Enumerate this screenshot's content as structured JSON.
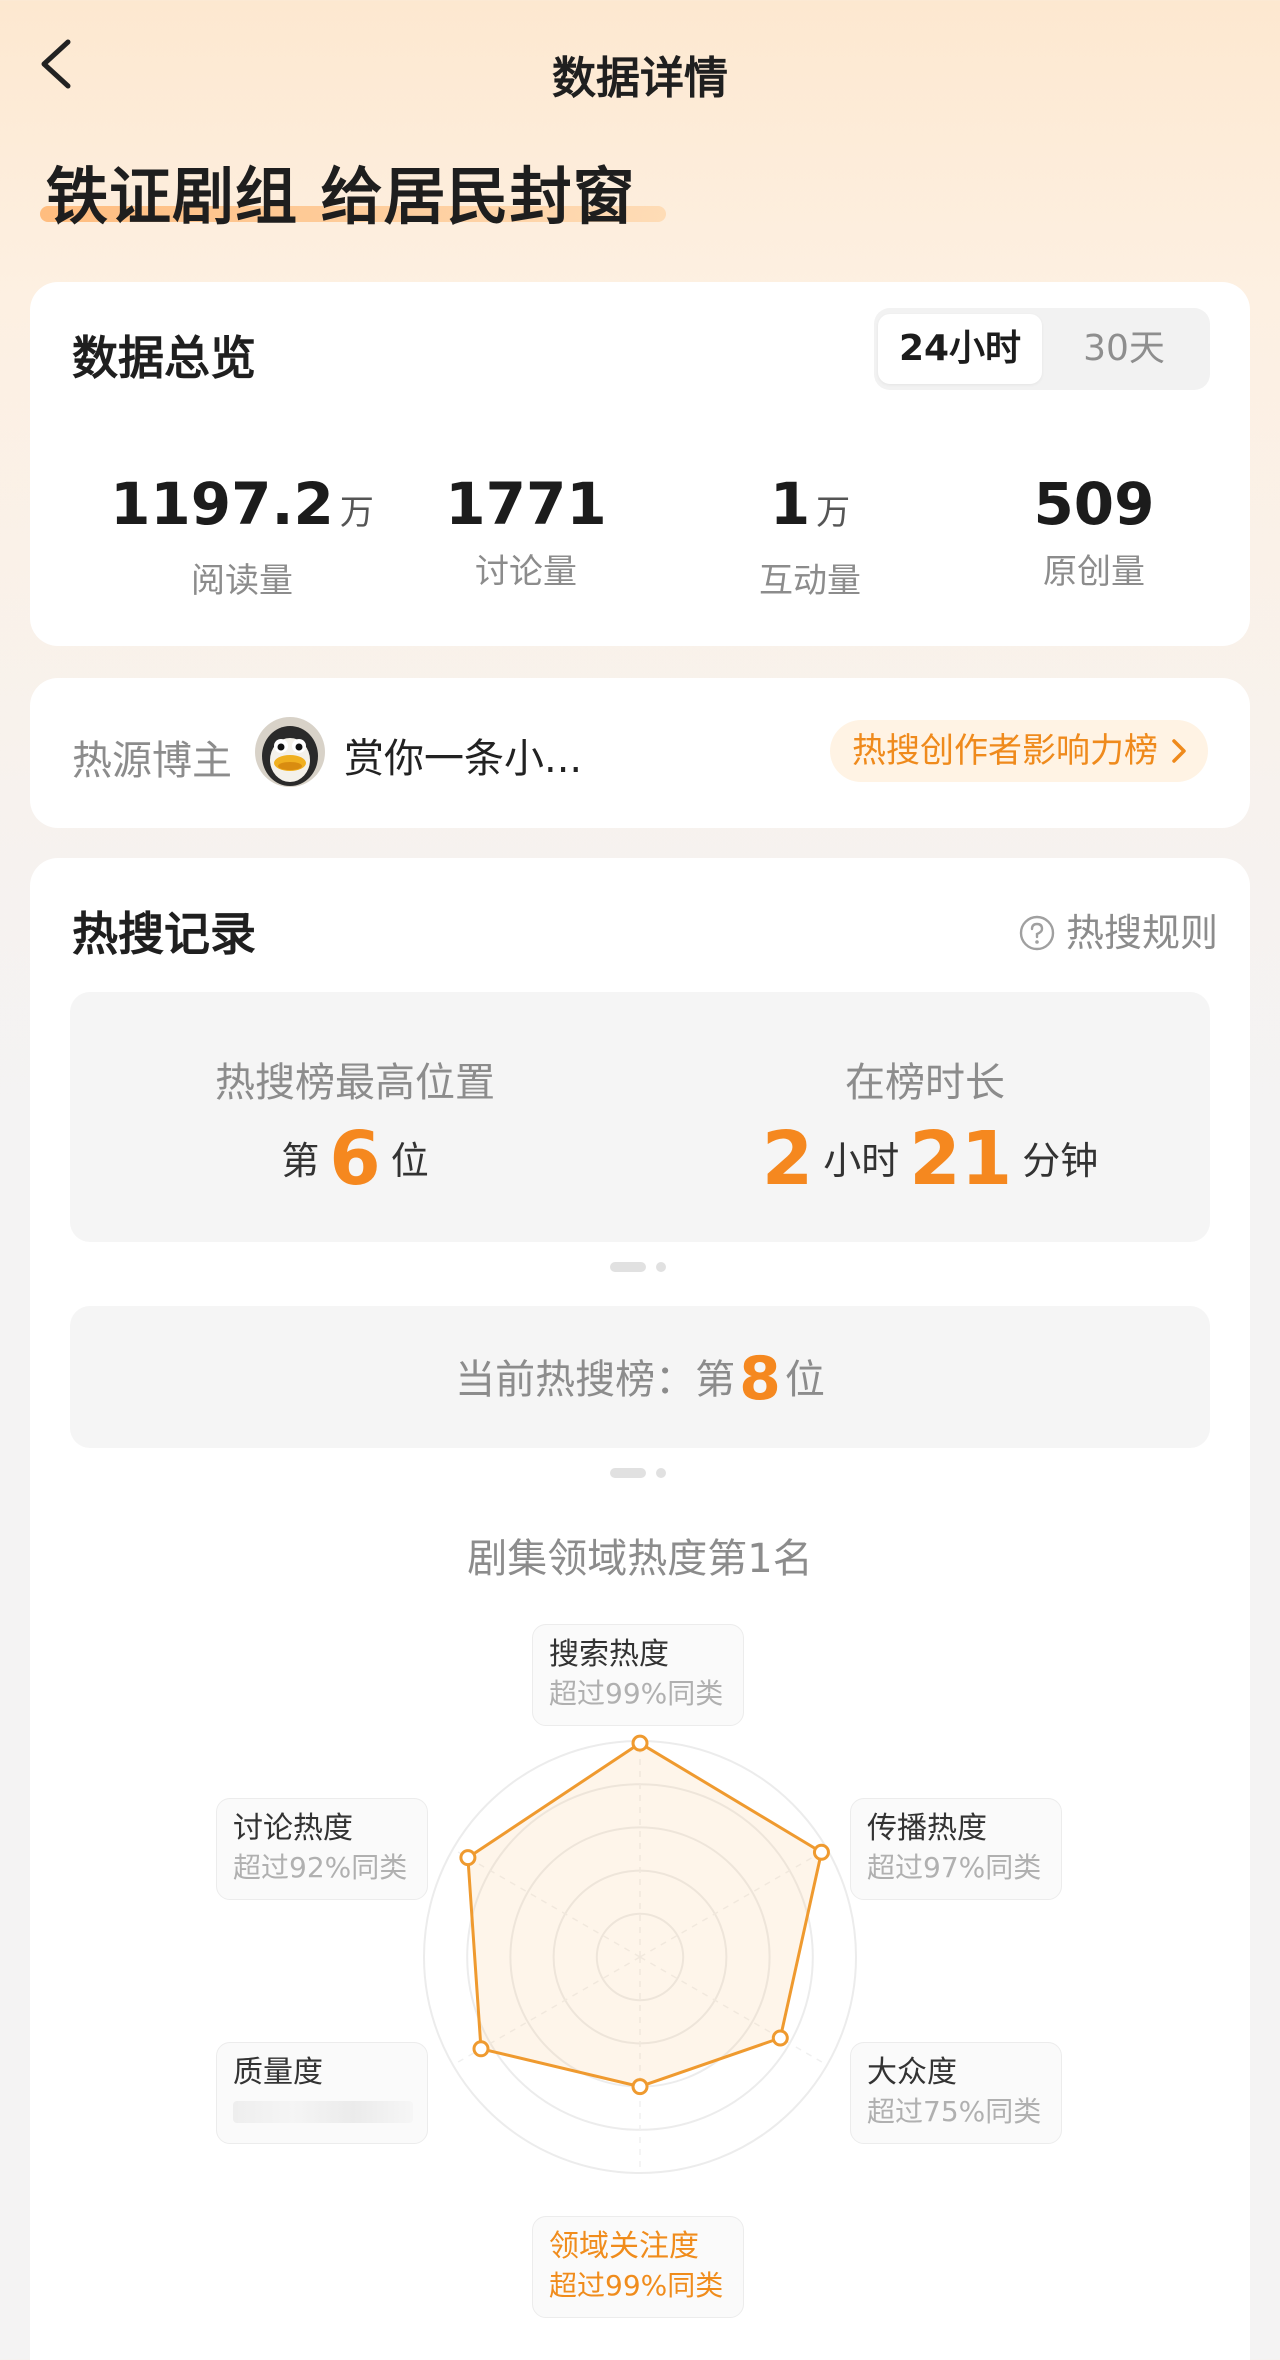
{
  "nav": {
    "title": "数据详情"
  },
  "topic": {
    "title": "铁证剧组 给居民封窗"
  },
  "overview": {
    "title": "数据总览",
    "tabs": [
      {
        "label": "24小时",
        "active": true
      },
      {
        "label": "30天",
        "active": false
      }
    ],
    "stats": [
      {
        "value": "1197.2",
        "unit": "万",
        "label": "阅读量"
      },
      {
        "value": "1771",
        "unit": "",
        "label": "讨论量"
      },
      {
        "value": "1",
        "unit": "万",
        "label": "互动量"
      },
      {
        "value": "509",
        "unit": "",
        "label": "原创量"
      }
    ]
  },
  "hot_source": {
    "label": "热源博主",
    "blogger_name": "赏你一条小...",
    "rank_link": "热搜创作者影响力榜"
  },
  "hot_record": {
    "title": "热搜记录",
    "rules": "热搜规则",
    "highest": {
      "title": "热搜榜最高位置",
      "prefix": "第",
      "number": "6",
      "suffix": "位"
    },
    "duration": {
      "title": "在榜时长",
      "hours": "2",
      "hours_unit": "小时",
      "minutes": "21",
      "minutes_unit": "分钟"
    },
    "current": {
      "label": "当前热搜榜：第",
      "number": "8",
      "suffix": "位"
    },
    "domain_rank": "剧集领域热度第1名"
  },
  "radar": {
    "accent_color": "#ef9a2f",
    "dimensions": [
      {
        "name": "搜索热度",
        "desc": "超过99%同类",
        "value": 0.99,
        "highlight": false
      },
      {
        "name": "传播热度",
        "desc": "超过97%同类",
        "value": 0.97,
        "highlight": false
      },
      {
        "name": "大众度",
        "desc": "超过75%同类",
        "value": 0.75,
        "highlight": false
      },
      {
        "name": "领域关注度",
        "desc": "超过99%同类",
        "value": 0.6,
        "highlight": true
      },
      {
        "name": "质量度",
        "desc": "",
        "value": 0.85,
        "highlight": false
      },
      {
        "name": "讨论热度",
        "desc": "超过92%同类",
        "value": 0.92,
        "highlight": false
      }
    ]
  },
  "colors": {
    "accent": "#f5881f",
    "link_bg": "#fff3e4"
  }
}
